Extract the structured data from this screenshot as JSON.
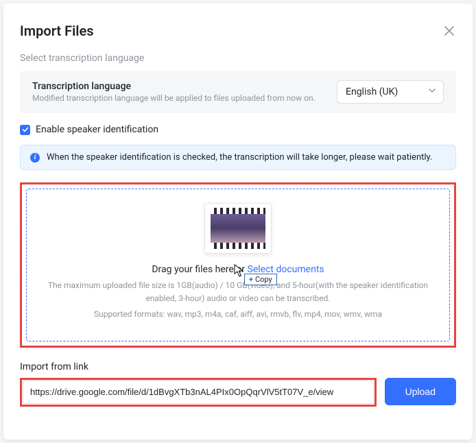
{
  "modal": {
    "title": "Import Files"
  },
  "langSection": {
    "caption": "Select transcription language",
    "title": "Transcription language",
    "sub": "Modified transcription language will be applied to files uploaded from now on.",
    "selected": "English (UK)"
  },
  "speaker": {
    "label": "Enable speaker identification",
    "checked": true
  },
  "info": {
    "text": "When the speaker identification is checked, the transcription will take longer, please wait patiently."
  },
  "dropzone": {
    "dragPrefix": "Drag your files here or ",
    "selectLink": "Select documents",
    "sizeNote": "The maximum uploaded file size is 1GB(audio) / 10 GB(video), and 5-hour(with the speaker identification enabled, 3-hour) audio or video can be transcribed.",
    "formatsNote": "Supported formats: wav, mp3, m4a, caf, aiff, avi, rmvb, flv, mp4, mov, wmv, wma"
  },
  "cursorTip": {
    "plus": "+",
    "label": "Copy"
  },
  "importLink": {
    "label": "Import from link",
    "value": "https://drive.google.com/file/d/1dBvgXTb3nAL4PIx0OpQqrVlV5tT07V_e/view",
    "uploadLabel": "Upload"
  }
}
